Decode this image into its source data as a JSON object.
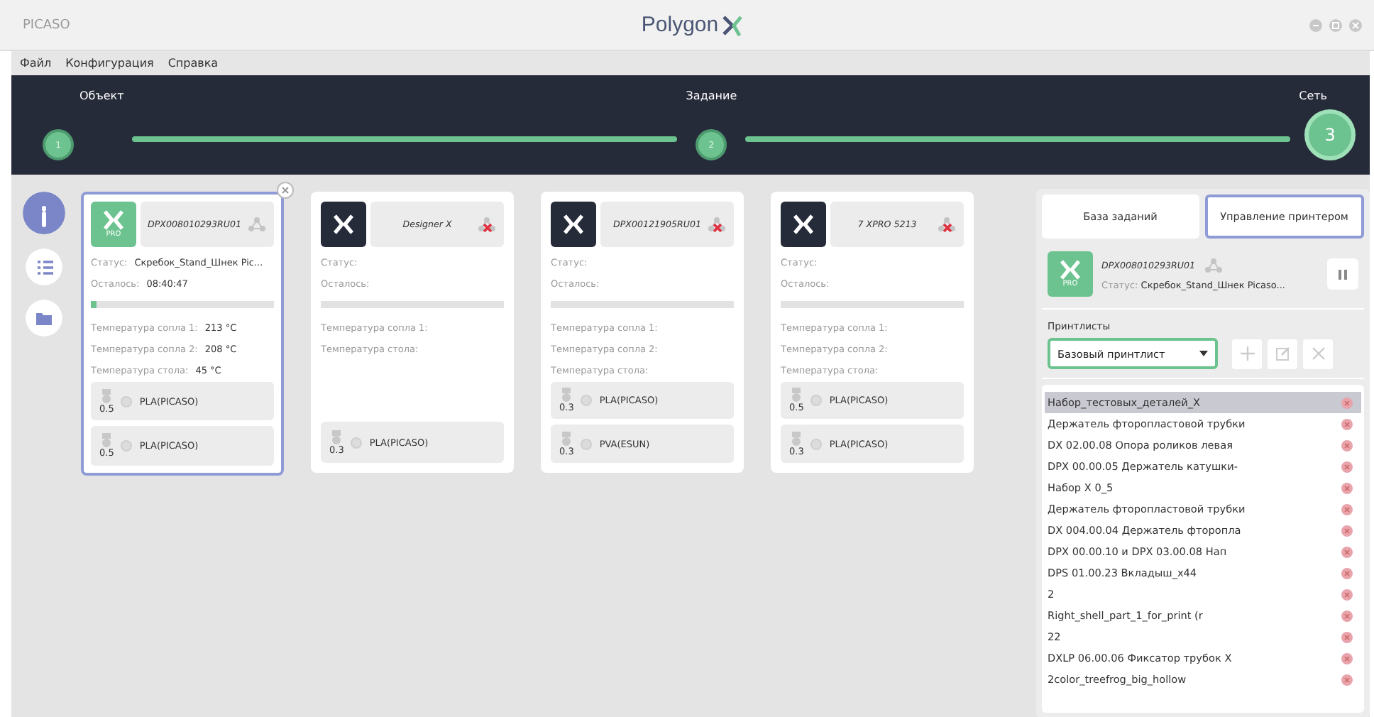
{
  "window": {
    "vendor": "PICASO",
    "logo_text": "Polygon"
  },
  "menu": [
    "Файл",
    "Конфигурация",
    "Справка"
  ],
  "steps": [
    {
      "label": "Объект",
      "number": "1",
      "selected": false
    },
    {
      "label": "Задание",
      "number": "2",
      "selected": false
    },
    {
      "label": "Сеть",
      "number": "3",
      "selected": true
    }
  ],
  "sidebar": [
    {
      "kind": "info",
      "selected": true
    },
    {
      "kind": "list",
      "selected": false
    },
    {
      "kind": "folder",
      "selected": false
    }
  ],
  "printers": [
    {
      "name": "DPX008010293RU01",
      "color": "#6cc38f",
      "badge": "PRO",
      "connected": true,
      "selected": true,
      "status_label": "Статус:",
      "status": "Скребок_Stand_Шнек Pic...",
      "remaining_label": "Осталось:",
      "remaining": "08:40:47",
      "level": 0.03,
      "temps": [
        {
          "label": "Температура сопла 1:",
          "value": "213 °C"
        },
        {
          "label": "Температура сопла 2:",
          "value": "208 °C"
        },
        {
          "label": "Температура стола:",
          "value": "45 °C"
        }
      ],
      "extruders": [
        {
          "nozzle": "0.5",
          "material": "PLA(PICASO)"
        },
        {
          "nozzle": "0.5",
          "material": "PLA(PICASO)"
        }
      ]
    },
    {
      "name": "Designer X",
      "color": "#262b3a",
      "connected": false,
      "selected": false,
      "status_label": "Статус:",
      "remaining_label": "Осталось:",
      "level": 0,
      "temps": [
        {
          "label": "Температура сопла 1:"
        },
        {
          "label": "Температура стола:"
        }
      ],
      "extruders": [
        {
          "nozzle": "0.3",
          "material": "PLA(PICASO)"
        }
      ]
    },
    {
      "name": "DPX00121905RU01",
      "color": "#262b3a",
      "connected": false,
      "selected": false,
      "status_label": "Статус:",
      "remaining_label": "Осталось:",
      "level": 0,
      "temps": [
        {
          "label": "Температура сопла 1:"
        },
        {
          "label": "Температура сопла 2:"
        },
        {
          "label": "Температура стола:"
        }
      ],
      "extruders": [
        {
          "nozzle": "0.3",
          "material": "PLA(PICASO)"
        },
        {
          "nozzle": "0.3",
          "material": "PVA(ESUN)"
        }
      ]
    },
    {
      "name": "7 XPRO 5213",
      "color": "#262b3a",
      "connected": false,
      "selected": false,
      "status_label": "Статус:",
      "remaining_label": "Осталось:",
      "level": 0,
      "temps": [
        {
          "label": "Температура сопла 1:"
        },
        {
          "label": "Температура сопла 2:"
        },
        {
          "label": "Температура стола:"
        }
      ],
      "extruders": [
        {
          "nozzle": "0.5",
          "material": "PLA(PICASO)"
        },
        {
          "nozzle": "0.3",
          "material": "PLA(PICASO)"
        }
      ]
    }
  ],
  "panel": {
    "tabs": [
      {
        "label": "База заданий",
        "selected": false
      },
      {
        "label": "Управление принтером",
        "selected": true
      }
    ],
    "printer": {
      "name": "DPX008010293RU01",
      "color": "#6cc38f",
      "badge": "PRO",
      "connected": true,
      "status_label": "Статус:",
      "status": "Скребок_Stand_Шнек Picaso..."
    },
    "printlists_label": "Принтлисты",
    "printlist": "Базовый принтлист",
    "jobs": [
      {
        "name": "Набор_тестовых_деталей_X",
        "selected": true
      },
      {
        "name": "Держатель фторопластовой трубки",
        "selected": false
      },
      {
        "name": "DX 02.00.08 Опора роликов левая",
        "selected": false
      },
      {
        "name": "DPX 00.00.05 Держатель катушки-",
        "selected": false
      },
      {
        "name": "Набор X 0_5",
        "selected": false
      },
      {
        "name": "Держатель фторопластовой трубки",
        "selected": false
      },
      {
        "name": "DX 004.00.04 Держатель фторопла",
        "selected": false
      },
      {
        "name": "DPX 00.00.10 и DPX 03.00.08 Нап",
        "selected": false
      },
      {
        "name": "DPS 01.00.23 Вкладыш_x44",
        "selected": false
      },
      {
        "name": "2",
        "selected": false
      },
      {
        "name": "Right_shell_part_1_for_print (r",
        "selected": false
      },
      {
        "name": "22",
        "selected": false
      },
      {
        "name": "DXLP 06.00.06 Фиксатор трубок X",
        "selected": false
      },
      {
        "name": "2color_treefrog_big_hollow",
        "selected": false
      }
    ]
  }
}
